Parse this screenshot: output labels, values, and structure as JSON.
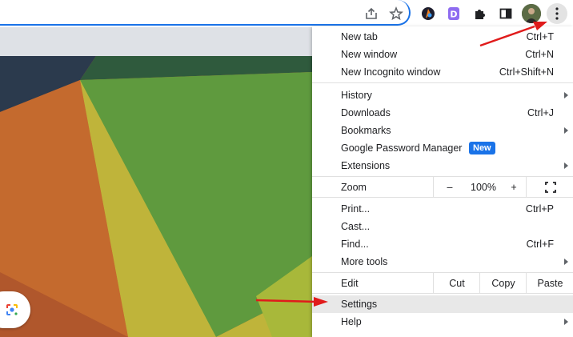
{
  "toolbar": {
    "icons": [
      "share-icon",
      "star-icon",
      "extension-a-icon",
      "extension-d-icon",
      "puzzle-icon",
      "sidepanel-icon",
      "avatar",
      "kebab-menu-icon"
    ]
  },
  "menu": {
    "new_tab": {
      "label": "New tab",
      "shortcut": "Ctrl+T"
    },
    "new_window": {
      "label": "New window",
      "shortcut": "Ctrl+N"
    },
    "new_incognito": {
      "label": "New Incognito window",
      "shortcut": "Ctrl+Shift+N"
    },
    "history": {
      "label": "History"
    },
    "downloads": {
      "label": "Downloads",
      "shortcut": "Ctrl+J"
    },
    "bookmarks": {
      "label": "Bookmarks"
    },
    "password_manager": {
      "label": "Google Password Manager",
      "badge": "New"
    },
    "extensions": {
      "label": "Extensions"
    },
    "zoom": {
      "label": "Zoom",
      "minus": "–",
      "value": "100%",
      "plus": "+"
    },
    "print": {
      "label": "Print...",
      "shortcut": "Ctrl+P"
    },
    "cast": {
      "label": "Cast..."
    },
    "find": {
      "label": "Find...",
      "shortcut": "Ctrl+F"
    },
    "more_tools": {
      "label": "More tools"
    },
    "edit": {
      "label": "Edit",
      "cut": "Cut",
      "copy": "Copy",
      "paste": "Paste"
    },
    "settings": {
      "label": "Settings"
    },
    "help": {
      "label": "Help"
    }
  },
  "colors": {
    "accent": "#1a73e8",
    "annotation_arrow": "#e01b1b"
  }
}
